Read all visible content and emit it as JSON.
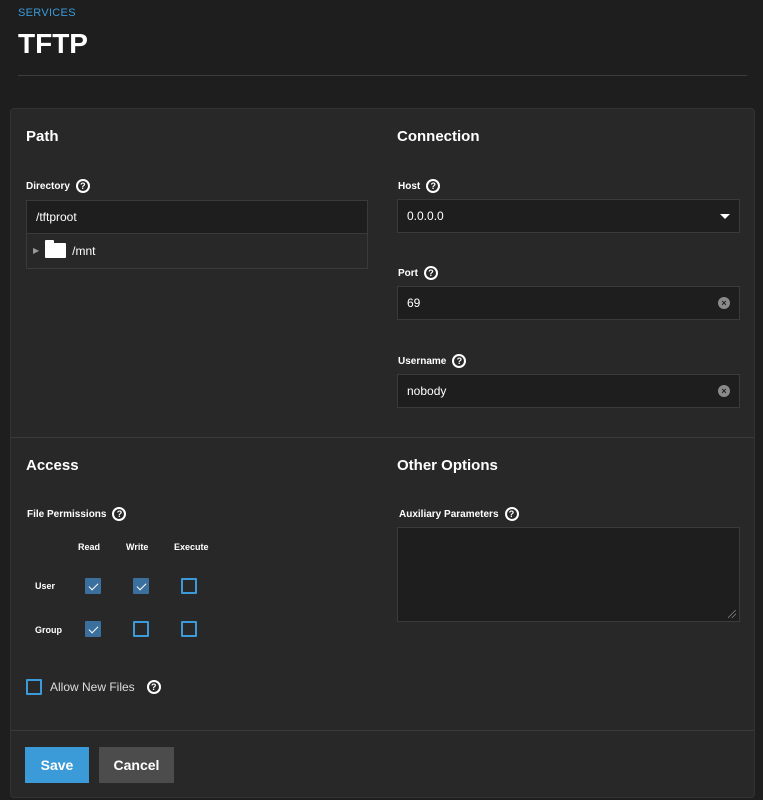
{
  "header": {
    "breadcrumb": "SERVICES",
    "title": "TFTP"
  },
  "path": {
    "section_title": "Path",
    "directory_label": "Directory",
    "directory_value": "/tftproot",
    "tree": [
      {
        "label": "/mnt"
      }
    ]
  },
  "connection": {
    "section_title": "Connection",
    "host_label": "Host",
    "host_value": "0.0.0.0",
    "port_label": "Port",
    "port_value": "69",
    "username_label": "Username",
    "username_value": "nobody"
  },
  "access": {
    "section_title": "Access",
    "file_permissions_label": "File Permissions",
    "columns": [
      "Read",
      "Write",
      "Execute"
    ],
    "rows": [
      {
        "label": "User",
        "read": true,
        "write": true,
        "execute": false
      },
      {
        "label": "Group",
        "read": true,
        "write": false,
        "execute": false
      }
    ],
    "allow_new_files_label": "Allow New Files",
    "allow_new_files": false
  },
  "other": {
    "section_title": "Other Options",
    "aux_label": "Auxiliary Parameters",
    "aux_value": ""
  },
  "actions": {
    "save_label": "Save",
    "cancel_label": "Cancel"
  },
  "colors": {
    "accent": "#3a9bd8",
    "checked": "#3a6f9e",
    "background": "#1e1e1e",
    "card": "#282828"
  },
  "icons": {
    "help": "?",
    "clear": "×",
    "help_icon": "help-circle-icon",
    "clear_icon": "clear-circle-icon",
    "dropdown_icon": "caret-down-icon",
    "folder_icon": "folder-icon",
    "expander_icon": "chevron-right-icon"
  }
}
